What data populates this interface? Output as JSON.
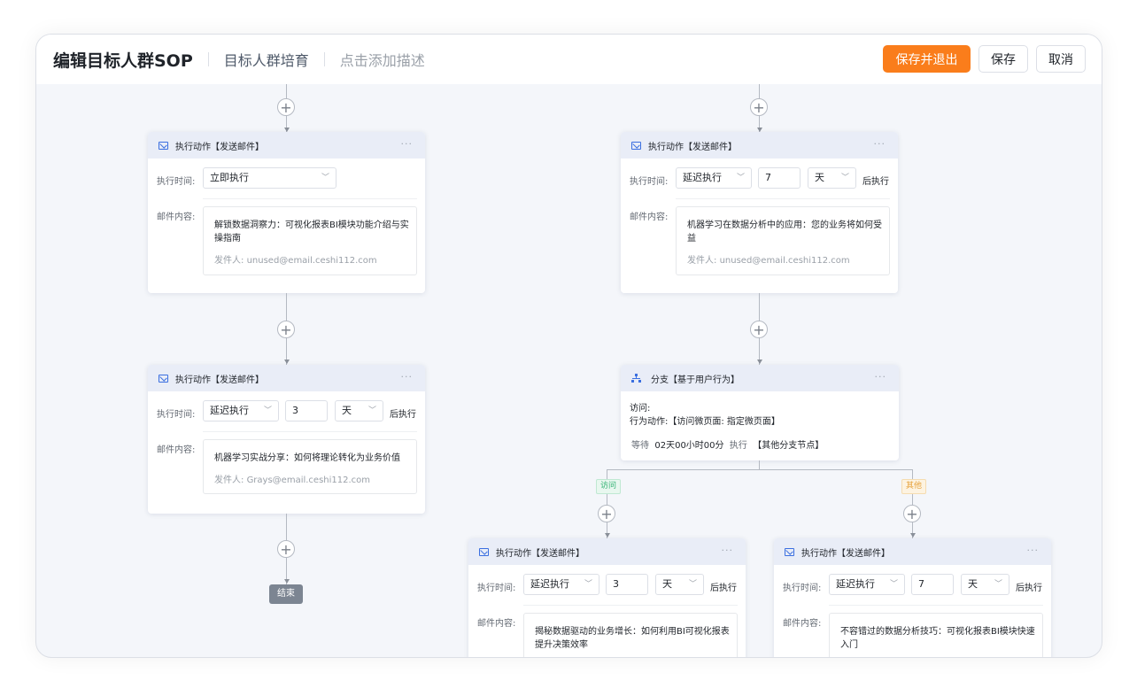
{
  "header": {
    "title": "编辑目标人群SOP",
    "subtitle": "目标人群培育",
    "description_placeholder": "点击添加描述",
    "save_exit_label": "保存并退出",
    "save_label": "保存",
    "cancel_label": "取消"
  },
  "labels": {
    "exec_time": "执行时间:",
    "mail_content": "邮件内容:",
    "after_exec": "后执行",
    "sender_prefix": "发件人:",
    "more": "···",
    "end": "结束"
  },
  "nodes": [
    {
      "title": "执行动作【发送邮件】",
      "timing": "立即执行",
      "subject": "解锁数据洞察力：可视化报表BI模块功能介绍与实操指南",
      "sender": "unused@email.ceshi112.com"
    },
    {
      "title": "执行动作【发送邮件】",
      "timing": "延迟执行",
      "delay": "3",
      "unit": "天",
      "subject": "机器学习实战分享：如何将理论转化为业务价值",
      "sender": "Grays@email.ceshi112.com"
    },
    {
      "title": "执行动作【发送邮件】",
      "timing": "延迟执行",
      "delay": "7",
      "unit": "天",
      "subject": "机器学习在数据分析中的应用：您的业务将如何受益",
      "sender": "unused@email.ceshi112.com"
    },
    {
      "title": "执行动作【发送邮件】",
      "timing": "延迟执行",
      "delay": "3",
      "unit": "天",
      "subject": "揭秘数据驱动的业务增长：如何利用BI可视化报表提升决策效率"
    },
    {
      "title": "执行动作【发送邮件】",
      "timing": "延迟执行",
      "delay": "7",
      "unit": "天",
      "subject": "不容错过的数据分析技巧：可视化报表BI模块快速入门"
    }
  ],
  "branch": {
    "title": "分支【基于用户行为】",
    "visit": "访问:",
    "action": "行为动作:【访问微页面: 指定微页面】",
    "wait_prefix": "等待",
    "wait_value": "02天00小时00分",
    "exec_word": "执行",
    "other_node": "【其他分支节点】",
    "tag_visit": "访问",
    "tag_other": "其他"
  },
  "colors": {
    "primary": "#fa7d1b",
    "accent_blue": "#3b6fe0",
    "tag_green": "#2fb170",
    "tag_orange": "#e6a23c"
  }
}
